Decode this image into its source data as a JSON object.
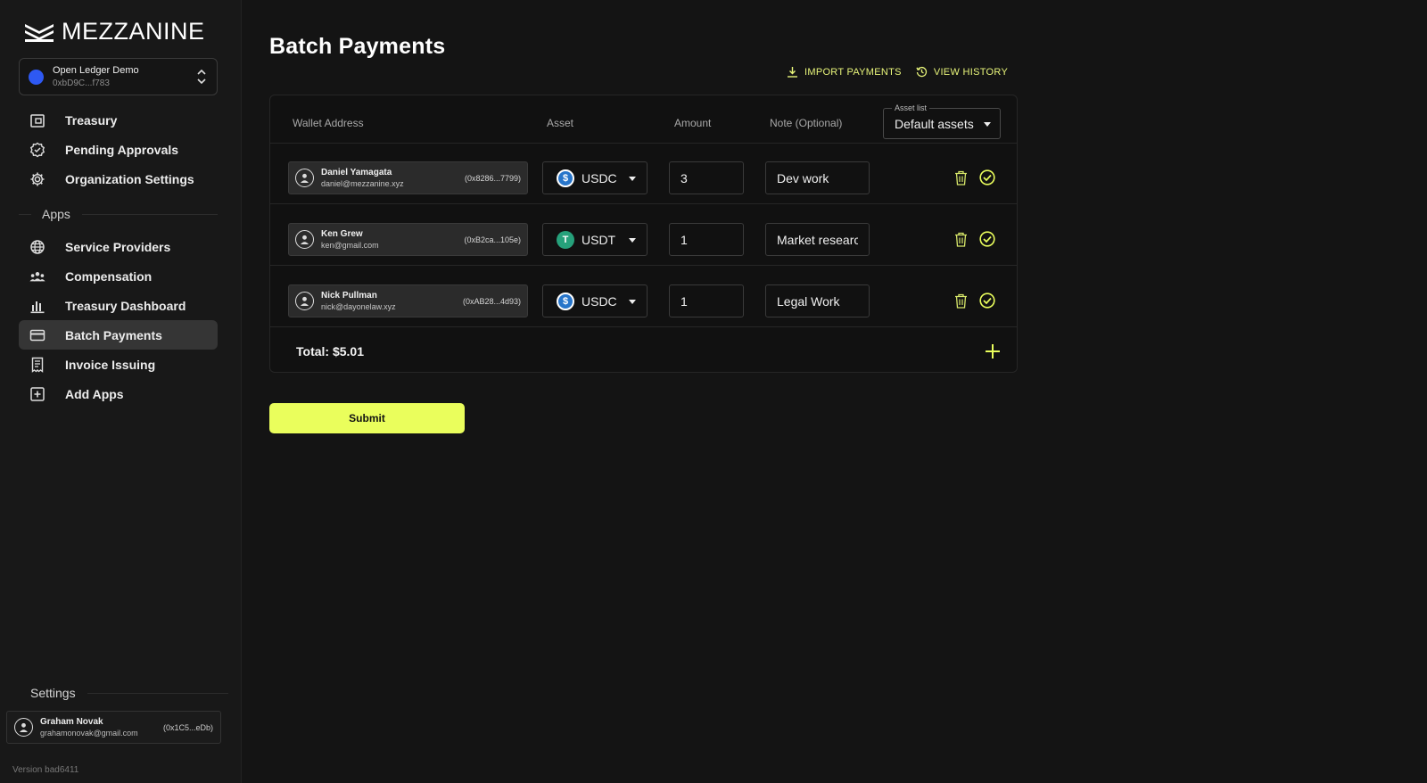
{
  "brand": {
    "name": "MEZZANINE"
  },
  "org": {
    "name": "Open Ledger Demo",
    "address": "0xbD9C...f783"
  },
  "nav": {
    "main": [
      {
        "label": "Treasury",
        "icon": "wallet-icon"
      },
      {
        "label": "Pending Approvals",
        "icon": "badge-check-icon"
      },
      {
        "label": "Organization Settings",
        "icon": "gear-icon"
      }
    ],
    "apps_label": "Apps",
    "apps": [
      {
        "label": "Service Providers",
        "icon": "globe-icon"
      },
      {
        "label": "Compensation",
        "icon": "people-icon"
      },
      {
        "label": "Treasury Dashboard",
        "icon": "bar-chart-icon"
      },
      {
        "label": "Batch Payments",
        "icon": "credit-card-icon",
        "active": true
      },
      {
        "label": "Invoice Issuing",
        "icon": "receipt-icon"
      },
      {
        "label": "Add Apps",
        "icon": "plus-square-icon"
      }
    ]
  },
  "settings": {
    "label": "Settings",
    "user": {
      "name": "Graham Novak",
      "email": "grahamonovak@gmail.com",
      "address": "(0x1C5...eDb)"
    }
  },
  "version": "Version bad6411",
  "page": {
    "title": "Batch Payments",
    "import_label": "IMPORT PAYMENTS",
    "history_label": "VIEW HISTORY",
    "accent_color": "#eafe5c"
  },
  "table": {
    "headers": {
      "wallet": "Wallet Address",
      "asset": "Asset",
      "amount": "Amount",
      "note": "Note (Optional)"
    },
    "asset_list": {
      "legend": "Asset list",
      "value": "Default assets"
    },
    "rows": [
      {
        "name": "Daniel Yamagata",
        "email": "daniel@mezzanine.xyz",
        "address": "(0x8286...7799)",
        "asset": "USDC",
        "coin": "usdc",
        "amount": "3",
        "note": "Dev work"
      },
      {
        "name": "Ken Grew",
        "email": "ken@gmail.com",
        "address": "(0xB2ca...105e)",
        "asset": "USDT",
        "coin": "usdt",
        "amount": "1",
        "note": "Market researc"
      },
      {
        "name": "Nick Pullman",
        "email": "nick@dayonelaw.xyz",
        "address": "(0xAB28...4d93)",
        "asset": "USDC",
        "coin": "usdc",
        "amount": "1",
        "note": "Legal Work"
      }
    ],
    "total": "Total: $5.01"
  },
  "submit_label": "Submit"
}
